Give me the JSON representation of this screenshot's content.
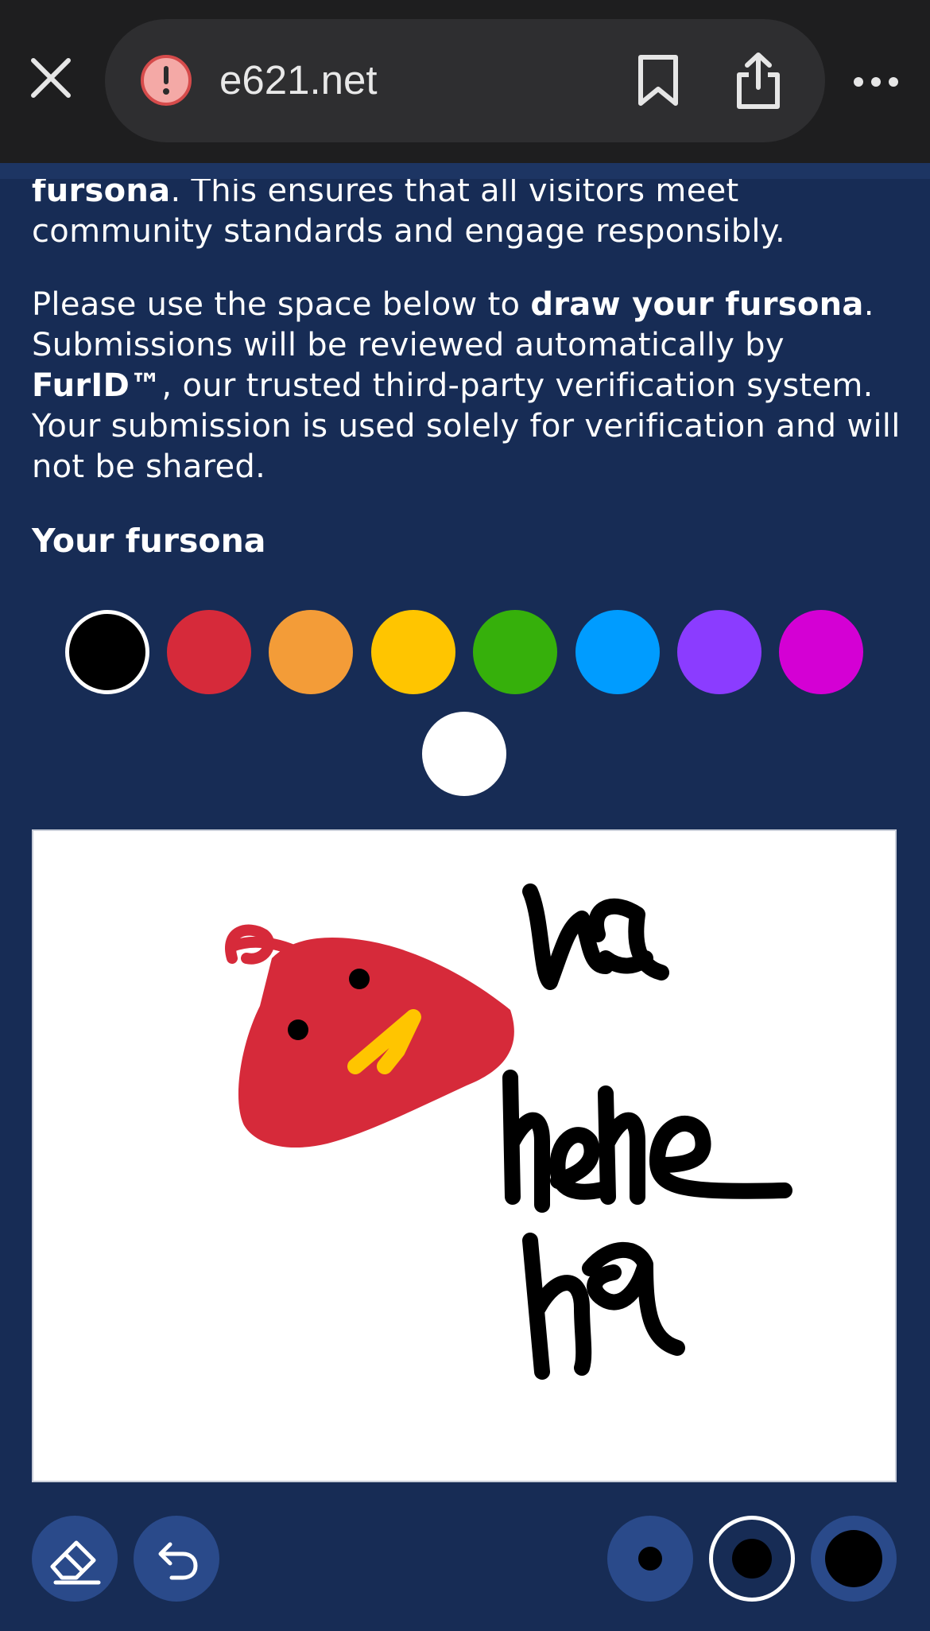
{
  "browser": {
    "url": "e621.net",
    "icons": {
      "close": "close-icon",
      "site_warning": "warning-icon",
      "bookmark": "bookmark-icon",
      "share": "share-icon",
      "more": "more-options-icon"
    }
  },
  "content": {
    "intro_bold": "fursona",
    "intro_rest": ". This ensures that all visitors meet community standards and engage responsibly.",
    "instructions": {
      "part1": "Please use the space below to ",
      "bold1": "draw your fursona",
      "part2": ". Submissions will be reviewed automatically by ",
      "bold2": "FurID™",
      "part3": ", our trusted third-party verification system. Your submission is used solely for verification and will not be shared."
    },
    "heading": "Your fursona"
  },
  "palette": {
    "colors": [
      "#000000",
      "#d62a3a",
      "#f39c38",
      "#ffc500",
      "#36b00b",
      "#009cff",
      "#8b3cff",
      "#d400d4",
      "#ffffff"
    ],
    "selected": "#000000"
  },
  "canvas": {
    "drawing_text": [
      "wa",
      "hehe",
      "ha"
    ],
    "drawing_colors": {
      "creature": "#d62a3a",
      "beak": "#ffc500",
      "ink": "#000000"
    }
  },
  "tools": {
    "eraser": "eraser-icon",
    "undo": "undo-icon",
    "brush_sizes": [
      "small",
      "medium",
      "large"
    ],
    "selected_size": "medium"
  }
}
